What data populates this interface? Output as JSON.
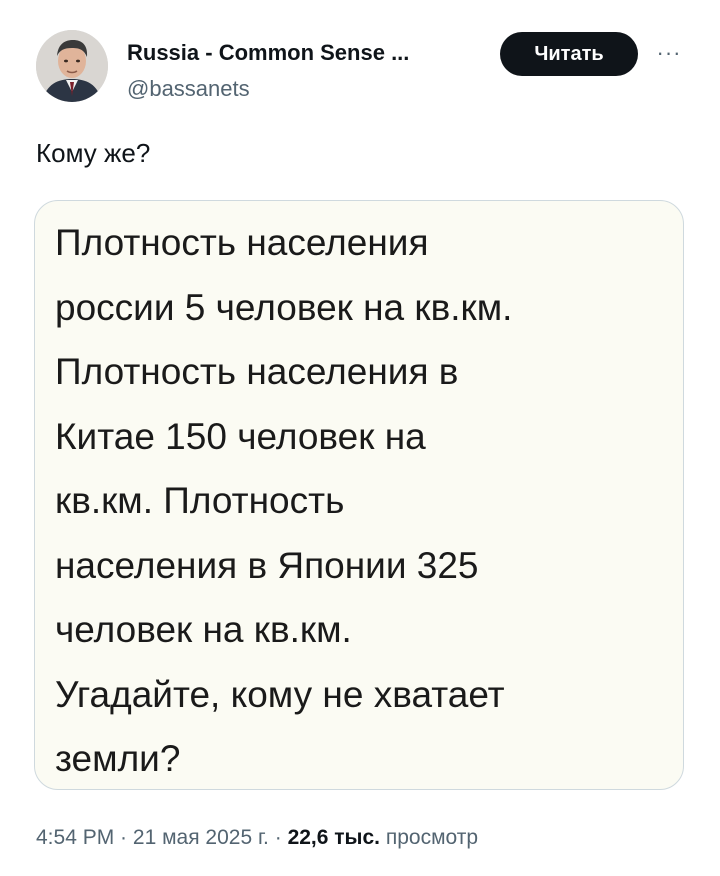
{
  "author": {
    "name": "Russia - Common Sense ...",
    "handle": "@bassanets",
    "avatar_icon": "user-portrait-icon"
  },
  "actions": {
    "follow_label": "Читать",
    "more_label": "···"
  },
  "tweet": {
    "text": "Кому же?"
  },
  "image_card": {
    "text": "Плотность населения\nроссии 5 человек на кв.км.\nПлотность населения в\nКитае 150 человек на\nкв.км. Плотность\nнаселения в Японии 325\nчеловек на кв.км.\nУгадайте, кому не хватает\nземли?"
  },
  "meta": {
    "time": "4:54 PM",
    "separator1": " · ",
    "date": "21 мая 2025 г.",
    "separator2": " · ",
    "views_count": "22,6 тыс.",
    "views_label": " просмотр"
  },
  "colors": {
    "text_primary": "#0f1419",
    "text_secondary": "#536471",
    "button_bg": "#0f1419",
    "card_border": "#cfd9de",
    "card_bg": "#fbfbf3"
  }
}
